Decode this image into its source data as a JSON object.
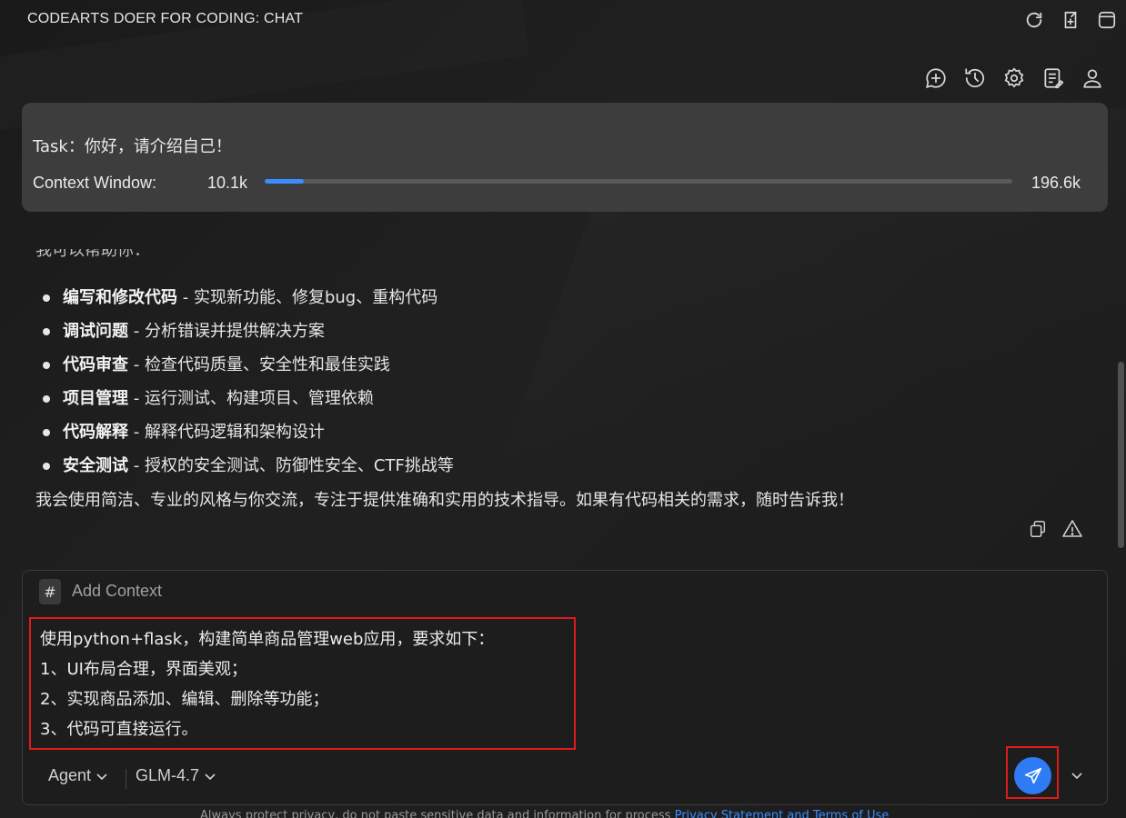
{
  "window": {
    "title": "CODEARTS DOER FOR CODING: CHAT"
  },
  "title_actions": [
    {
      "name": "refresh-icon"
    },
    {
      "name": "export-icon"
    },
    {
      "name": "panel-icon"
    }
  ],
  "toolbar": [
    {
      "name": "new-chat-icon"
    },
    {
      "name": "history-icon"
    },
    {
      "name": "settings-icon"
    },
    {
      "name": "notes-icon"
    },
    {
      "name": "account-icon"
    }
  ],
  "task": {
    "label": "Task：你好，请介绍自己！",
    "context_label": "Context Window:",
    "context_used": "10.1k",
    "context_total": "196.6k",
    "context_fraction": 0.052,
    "accent": "#3b8cff"
  },
  "chat": {
    "partial_line": "我可以帮助你：",
    "bullets": [
      {
        "title": "编写和修改代码",
        "desc": " - 实现新功能、修复bug、重构代码"
      },
      {
        "title": "调试问题",
        "desc": " - 分析错误并提供解决方案"
      },
      {
        "title": "代码审查",
        "desc": " - 检查代码质量、安全性和最佳实践"
      },
      {
        "title": "项目管理",
        "desc": " - 运行测试、构建项目、管理依赖"
      },
      {
        "title": "代码解释",
        "desc": " - 解释代码逻辑和架构设计"
      },
      {
        "title": "安全测试",
        "desc": " - 授权的安全测试、防御性安全、CTF挑战等"
      }
    ],
    "closing": "我会使用简洁、专业的风格与你交流，专注于提供准确和实用的技术指导。如果有代码相关的需求，随时告诉我！"
  },
  "input": {
    "hash_label": "#",
    "add_context": "Add Context",
    "prompt_lines": [
      "使用python+flask，构建简单商品管理web应用，要求如下：",
      "1、UI布局合理，界面美观；",
      "2、实现商品添加、编辑、删除等功能；",
      "3、代码可直接运行。"
    ],
    "mode": "Agent",
    "model": "GLM-4.7",
    "send_color": "#2f7bf5",
    "highlight_color": "#e01b1b"
  },
  "footer": {
    "text": "Always protect privacy, do not paste sensitive data and information for process ",
    "links": "Privacy Statement and Terms of Use"
  }
}
